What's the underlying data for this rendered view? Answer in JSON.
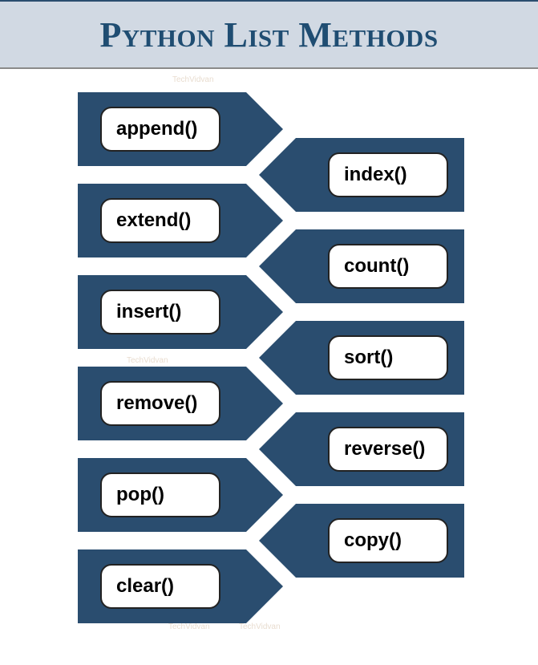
{
  "title": "Python List Methods",
  "watermark": "TechVidvan",
  "left_methods": [
    {
      "label": "append()"
    },
    {
      "label": "extend()"
    },
    {
      "label": "insert()"
    },
    {
      "label": "remove()"
    },
    {
      "label": "pop()"
    },
    {
      "label": "clear()"
    }
  ],
  "right_methods": [
    {
      "label": "index()"
    },
    {
      "label": "count()"
    },
    {
      "label": "sort()"
    },
    {
      "label": "reverse()"
    },
    {
      "label": "copy()"
    }
  ]
}
